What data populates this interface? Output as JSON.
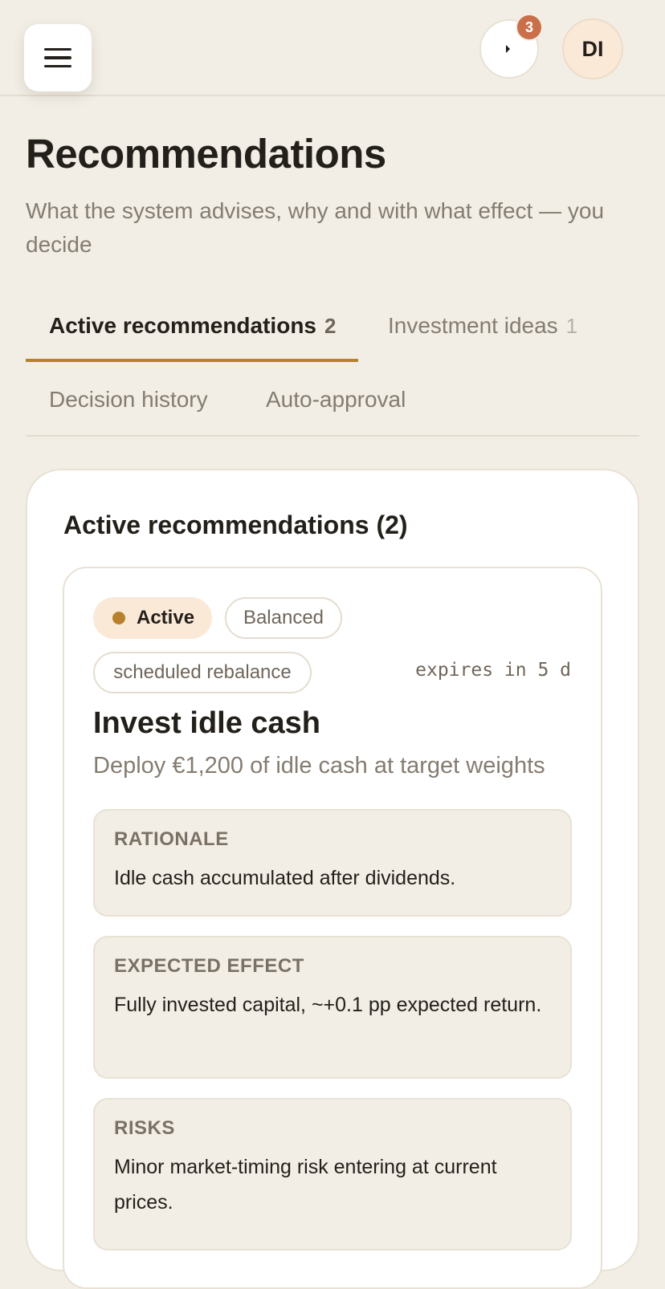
{
  "header": {
    "menu_icon": "hamburger-icon",
    "notification_icon": "notification-icon",
    "notification_count": "3",
    "avatar_initials": "DI"
  },
  "page": {
    "title": "Recommendations",
    "subtitle": "What the system advises, why and with what effect — you decide"
  },
  "tabs": [
    {
      "label": "Active recommendations",
      "count": "2",
      "active": true
    },
    {
      "label": "Investment ideas",
      "count": "1",
      "active": false
    },
    {
      "label": "Decision history",
      "active": false
    },
    {
      "label": "Auto-approval",
      "active": false
    }
  ],
  "panel": {
    "title": "Active recommendations (2)"
  },
  "recommendation": {
    "status": "Active",
    "profile": "Balanced",
    "trigger": "scheduled rebalance",
    "expires": "expires in 5 d",
    "title": "Invest idle cash",
    "description": "Deploy €1,200 of idle cash at target weights",
    "rationale_label": "RATIONALE",
    "rationale": "Idle cash accumulated after dividends.",
    "effect_label": "EXPECTED EFFECT",
    "effect": "Fully invested capital, ~+0.1 pp expected return.",
    "risks_label": "RISKS",
    "risks": "Minor market-timing risk entering at current prices."
  },
  "colors": {
    "background": "#f2eee6",
    "accent": "#b8812e",
    "badge": "#c9704a",
    "active_chip": "#fbe9d8"
  }
}
